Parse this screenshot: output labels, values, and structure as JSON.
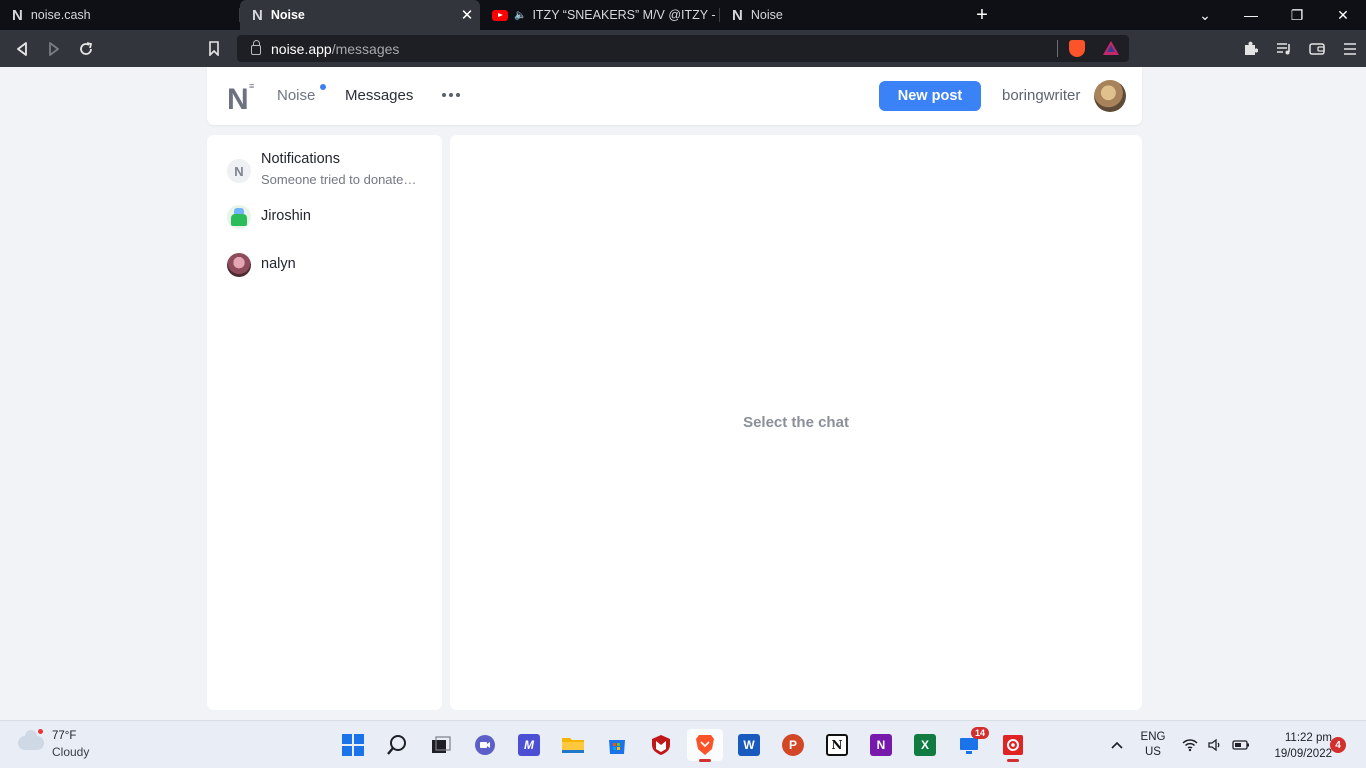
{
  "browser": {
    "tabs": [
      {
        "title": "noise.cash",
        "active": false
      },
      {
        "title": "Noise",
        "active": true
      },
      {
        "title": "ITZY “SNEAKERS” M/V @ITZY - You",
        "active": false
      },
      {
        "title": "Noise",
        "active": false
      }
    ],
    "close_tab_glyph": "✕",
    "new_tab_glyph": "+",
    "url_host": "noise.app",
    "url_path": "/messages",
    "window_controls": [
      "⌄",
      "—",
      "❐",
      "✕"
    ]
  },
  "header": {
    "logo_letter": "N",
    "logo_marks": "≡",
    "nav_noise": "Noise",
    "nav_messages": "Messages",
    "new_post_label": "New post",
    "username": "boringwriter",
    "accent_color": "#3b82f6"
  },
  "sidebar": {
    "conversations": [
      {
        "name": "Notifications",
        "preview": "Someone tried to donate…",
        "avatar": "N"
      },
      {
        "name": "Jiroshin",
        "preview": ""
      },
      {
        "name": "nalyn",
        "preview": ""
      }
    ]
  },
  "chat": {
    "empty_text": "Select the chat"
  },
  "taskbar": {
    "weather_temp": "77°F",
    "weather_cond": "Cloudy",
    "badge_count": "14",
    "lang_primary": "ENG",
    "lang_secondary": "US",
    "time": "11:22 pm",
    "date": "19/09/2022",
    "notification_count": "4",
    "app_letters": {
      "word": "W",
      "powerpoint": "P",
      "notion": "N",
      "onenote": "N",
      "excel": "X"
    }
  }
}
